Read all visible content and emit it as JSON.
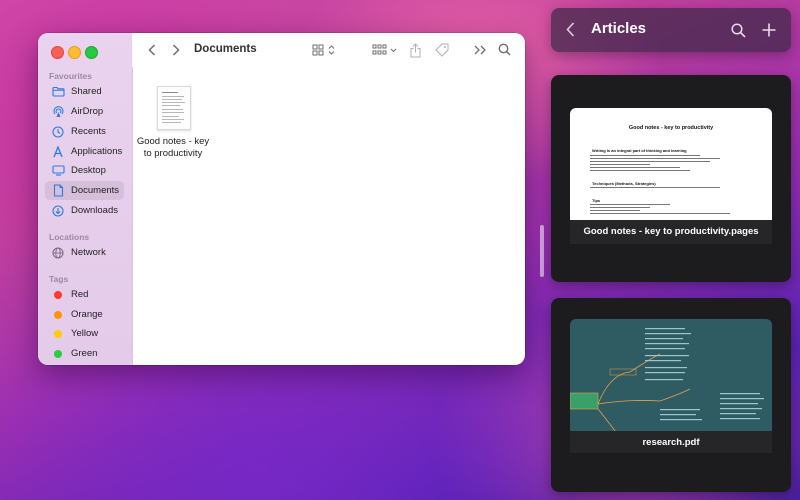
{
  "finder": {
    "title": "Documents",
    "sidebar": {
      "favourites_heading": "Favourites",
      "favourites": [
        {
          "label": "Shared",
          "icon": "folder-icon"
        },
        {
          "label": "AirDrop",
          "icon": "airdrop-icon"
        },
        {
          "label": "Recents",
          "icon": "clock-icon"
        },
        {
          "label": "Applications",
          "icon": "applications-icon"
        },
        {
          "label": "Desktop",
          "icon": "desktop-icon"
        },
        {
          "label": "Documents",
          "icon": "document-icon",
          "active": true
        },
        {
          "label": "Downloads",
          "icon": "download-icon"
        }
      ],
      "locations_heading": "Locations",
      "locations": [
        {
          "label": "Network",
          "icon": "globe-icon"
        }
      ],
      "tags_heading": "Tags",
      "tags": [
        {
          "label": "Red",
          "color": "#ff3b30"
        },
        {
          "label": "Orange",
          "color": "#ff9500"
        },
        {
          "label": "Yellow",
          "color": "#ffcc00"
        },
        {
          "label": "Green",
          "color": "#28cd41"
        }
      ]
    },
    "files": [
      {
        "name_line1": "Good notes - key",
        "name_line2": "to productivity"
      }
    ]
  },
  "articles": {
    "title": "Articles",
    "cards": [
      {
        "label": "Good notes - key to productivity.pages",
        "preview": {
          "heading": "Good notes - key to productivity",
          "section1": "Writing is an integral part of thinking and learning",
          "section2": "Techniques (Methods, Strategies)",
          "section3": "Tips"
        }
      },
      {
        "label": "research.pdf"
      }
    ]
  }
}
